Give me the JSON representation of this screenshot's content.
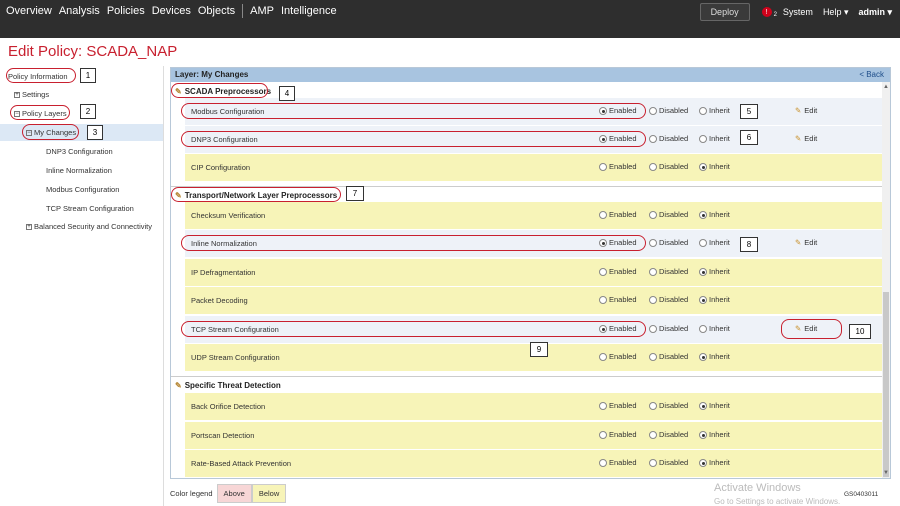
{
  "nav": {
    "items": [
      "Overview",
      "Analysis",
      "Policies",
      "Devices",
      "Objects"
    ],
    "items2": [
      "AMP",
      "Intelligence"
    ],
    "deploy": "Deploy",
    "alert_count": "2",
    "system": "System",
    "help": "Help ▾",
    "user": "admin ▾"
  },
  "page_title": "Edit Policy: SCADA_NAP",
  "sidebar": {
    "policy_information": "Policy Information",
    "settings": "Settings",
    "policy_layers": "Policy Layers",
    "my_changes": "My Changes",
    "children": [
      "DNP3 Configuration",
      "Inline Normalization",
      "Modbus Configuration",
      "TCP Stream Configuration"
    ],
    "balanced": "Balanced Security and Connectivity"
  },
  "main": {
    "header": "Layer: My Changes",
    "back": "< Back",
    "radio_labels": {
      "enabled": "Enabled",
      "disabled": "Disabled",
      "inherit": "Inherit"
    },
    "edit_label": "Edit",
    "sections": [
      {
        "title": "SCADA Preprocessors",
        "rows": [
          {
            "name": "Modbus Configuration",
            "state": "enabled",
            "edit": true,
            "bg": "mine"
          },
          {
            "name": "DNP3 Configuration",
            "state": "enabled",
            "edit": true,
            "bg": "mine"
          },
          {
            "name": "CIP Configuration",
            "state": "inherit",
            "edit": false,
            "bg": "below"
          }
        ]
      },
      {
        "title": "Transport/Network Layer Preprocessors",
        "rows": [
          {
            "name": "Checksum Verification",
            "state": "inherit",
            "edit": false,
            "bg": "below"
          },
          {
            "name": "Inline Normalization",
            "state": "enabled",
            "edit": true,
            "bg": "mine"
          },
          {
            "name": "IP Defragmentation",
            "state": "inherit",
            "edit": false,
            "bg": "below"
          },
          {
            "name": "Packet Decoding",
            "state": "inherit",
            "edit": false,
            "bg": "below"
          },
          {
            "name": "TCP Stream Configuration",
            "state": "enabled",
            "edit": true,
            "bg": "mine"
          },
          {
            "name": "UDP Stream Configuration",
            "state": "inherit",
            "edit": false,
            "bg": "below"
          }
        ]
      },
      {
        "title": "Specific Threat Detection",
        "rows": [
          {
            "name": "Back Orifice Detection",
            "state": "inherit",
            "edit": false,
            "bg": "below"
          },
          {
            "name": "Portscan Detection",
            "state": "inherit",
            "edit": false,
            "bg": "below"
          },
          {
            "name": "Rate-Based Attack Prevention",
            "state": "inherit",
            "edit": false,
            "bg": "below"
          }
        ]
      }
    ]
  },
  "callouts": [
    "1",
    "2",
    "3",
    "4",
    "5",
    "6",
    "7",
    "8",
    "9",
    "10"
  ],
  "legend": {
    "label": "Color legend",
    "above": "Above",
    "below": "Below"
  },
  "watermark": {
    "line1": "Activate Windows",
    "line2": "Go to Settings to activate Windows."
  },
  "figure_id": "GS0403011"
}
